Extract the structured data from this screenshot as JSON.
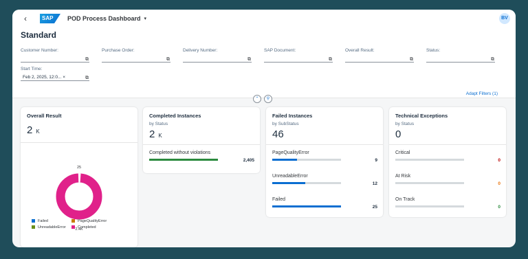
{
  "shell": {
    "app_title": "POD Process Dashboard",
    "logo_text": "SAP",
    "avatar": "BV",
    "back_icon": "back-arrow-icon"
  },
  "page": {
    "title": "Standard",
    "adapt_filters": "Adapt Filters (1)"
  },
  "filters": [
    {
      "label": "Customer Number:",
      "value": ""
    },
    {
      "label": "Purchase Order:",
      "value": ""
    },
    {
      "label": "Delivery Number:",
      "value": ""
    },
    {
      "label": "SAP Document:",
      "value": ""
    },
    {
      "label": "Overall Result:",
      "value": ""
    },
    {
      "label": "Status:",
      "value": ""
    }
  ],
  "start_time": {
    "label": "Start Time:",
    "value": "Feb 2, 2025, 12:0...",
    "clear": "×"
  },
  "cards": {
    "overall": {
      "title": "Overall Result",
      "kpi": "2",
      "unit": "K",
      "donut_small_label": "25",
      "donut_big_label": "2.4K",
      "donut_values": {
        "Failed": 25,
        "PageQualityError": 9,
        "UnreadableError": 12,
        "Completed": 2405
      },
      "legend": [
        "Failed",
        "PageQualityError",
        "UnreadableError",
        "Completed"
      ],
      "colors": {
        "Failed": "#0a6ed1",
        "PageQualityError": "#c87b00",
        "UnreadableError": "#6a8f1a",
        "Completed": "#e0218a"
      }
    },
    "completed": {
      "title": "Completed Instances",
      "sub": "by Status",
      "kpi": "2",
      "unit": "K",
      "items": [
        {
          "label": "Completed without violations",
          "value": "2,405",
          "fraction": 1.0,
          "color": "#2b8a3e"
        }
      ]
    },
    "failed": {
      "title": "Failed Instances",
      "sub": "by SubStatus",
      "kpi": "46",
      "items": [
        {
          "label": "PageQualityError",
          "value": "9",
          "fraction": 0.36,
          "color": "#0a6ed1"
        },
        {
          "label": "UnreadableError",
          "value": "12",
          "fraction": 0.48,
          "color": "#0a6ed1"
        },
        {
          "label": "Failed",
          "value": "25",
          "fraction": 1.0,
          "color": "#0a6ed1"
        }
      ]
    },
    "technical": {
      "title": "Technical Exceptions",
      "sub": "by Status",
      "kpi": "0",
      "items": [
        {
          "label": "Critical",
          "value": "0",
          "fraction": 0,
          "color": "#bb0000"
        },
        {
          "label": "At Risk",
          "value": "0",
          "fraction": 0,
          "color": "#e9730c"
        },
        {
          "label": "On Track",
          "value": "0",
          "fraction": 0,
          "color": "#2b8a3e"
        }
      ]
    }
  }
}
